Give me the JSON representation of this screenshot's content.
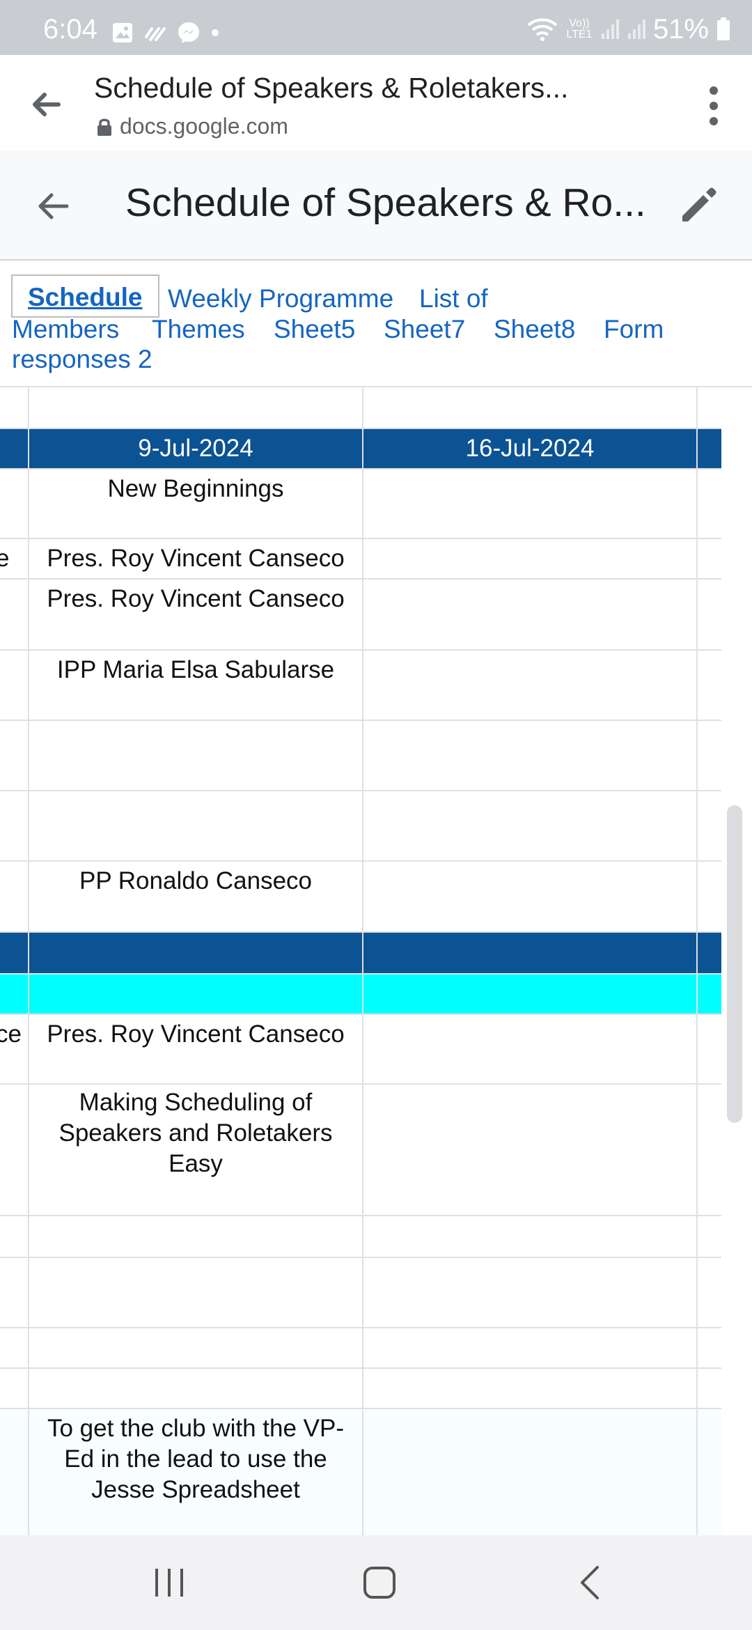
{
  "status_bar": {
    "time": "6:04",
    "battery": "51%",
    "network_label": "Vo)) LTE1"
  },
  "browser": {
    "page_title": "Schedule of Speakers & Roletakers...",
    "domain": "docs.google.com"
  },
  "sheet": {
    "title": "Schedule of Speakers & Ro..."
  },
  "tabs": [
    {
      "label": "Schedule",
      "active": true
    },
    {
      "label": "Weekly Programme"
    },
    {
      "label": "List of"
    },
    {
      "label": "Members"
    },
    {
      "label": "Themes"
    },
    {
      "label": "Sheet5"
    },
    {
      "label": "Sheet7"
    },
    {
      "label": "Sheet8"
    },
    {
      "label": "Form"
    },
    {
      "label": "responses 2"
    }
  ],
  "grid": {
    "header": {
      "date1": "9-Jul-2024",
      "date2": "16-Jul-2024"
    },
    "rows": [
      {
        "c0": "",
        "c1": "New Beginnings",
        "c2": ""
      },
      {
        "c0": "e",
        "c1": "Pres. Roy Vincent Canseco",
        "c2": ""
      },
      {
        "c0": "",
        "c1": "Pres. Roy Vincent Canseco",
        "c2": ""
      },
      {
        "c0": "",
        "c1": "IPP Maria Elsa Sabularse",
        "c2": ""
      },
      {
        "c0": "",
        "c1": "",
        "c2": ""
      },
      {
        "c0": "",
        "c1": "",
        "c2": ""
      },
      {
        "c0": "",
        "c1": "PP Ronaldo Canseco",
        "c2": ""
      },
      {
        "c0": "ce",
        "c1": "Pres. Roy Vincent Canseco",
        "c2": ""
      },
      {
        "c0": "",
        "c1": "Making Scheduling of Speakers and Roletakers Easy",
        "c2": ""
      },
      {
        "c0": "",
        "c1": "To get the club with the VP-Ed in the lead to use the Jesse Spreadsheet",
        "c2": ""
      }
    ]
  },
  "colors": {
    "header_blue": "#0c5394",
    "section_cyan": "#00ffff",
    "tab_link": "#1565c0",
    "gridline": "#e0e0e0"
  },
  "icons": {
    "browser_back": "arrow-left-icon",
    "browser_menu": "more-vert-icon",
    "sheet_back": "arrow-left-icon",
    "sheet_edit": "pencil-icon",
    "nav_recents": "recents-icon",
    "nav_home": "home-icon",
    "nav_back": "back-chevron-icon"
  }
}
